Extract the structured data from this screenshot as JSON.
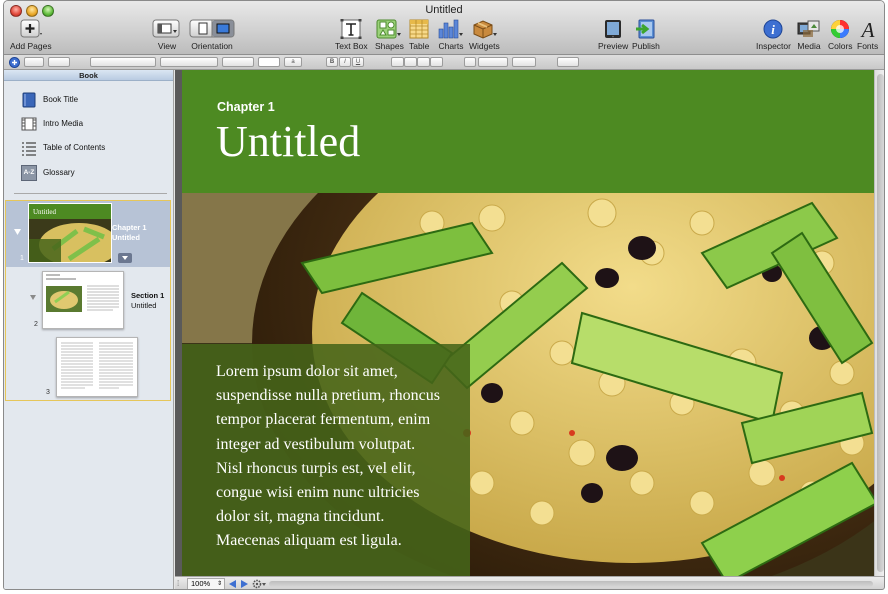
{
  "window": {
    "title": "Untitled"
  },
  "toolbar": {
    "add_pages": "Add Pages",
    "view": "View",
    "orientation": "Orientation",
    "text_box": "Text Box",
    "shapes": "Shapes",
    "table": "Table",
    "charts": "Charts",
    "widgets": "Widgets",
    "preview": "Preview",
    "publish": "Publish",
    "inspector": "Inspector",
    "media": "Media",
    "colors": "Colors",
    "fonts": "Fonts"
  },
  "format_bar": {
    "font_size_letter": "a",
    "bold": "B",
    "italic": "I",
    "underline": "U"
  },
  "sidebar": {
    "header": "Book",
    "items": [
      {
        "label": "Book Title",
        "icon": "book-icon"
      },
      {
        "label": "Intro Media",
        "icon": "film-icon"
      },
      {
        "label": "Table of Contents",
        "icon": "list-icon"
      },
      {
        "label": "Glossary",
        "icon": "glossary-icon"
      }
    ],
    "glossary_icon_text": "A-Z",
    "thumbnails": [
      {
        "number": "1",
        "title": "Chapter 1",
        "subtitle": "Untitled",
        "mini_title": "Untitled"
      },
      {
        "number": "2",
        "title": "Section 1",
        "subtitle": "Untitled"
      },
      {
        "number": "3"
      }
    ]
  },
  "page": {
    "chapter_label": "Chapter 1",
    "title": "Untitled",
    "body_lines": [
      "Lorem ipsum dolor sit amet,",
      "suspendisse nulla pretium, rhoncus",
      "tempor placerat fermentum, enim",
      "integer ad vestibulum volutpat.",
      "Nisl rhoncus turpis est, vel elit,",
      "congue wisi enim nunc ultricies",
      "dolor sit, magna tincidunt.",
      "Maecenas aliquam est ligula."
    ]
  },
  "bottom_bar": {
    "zoom": "100%"
  },
  "colors": {
    "banner_green": "#4d8a22",
    "text_panel": "#46641a",
    "selection_border": "#e6c65a"
  }
}
